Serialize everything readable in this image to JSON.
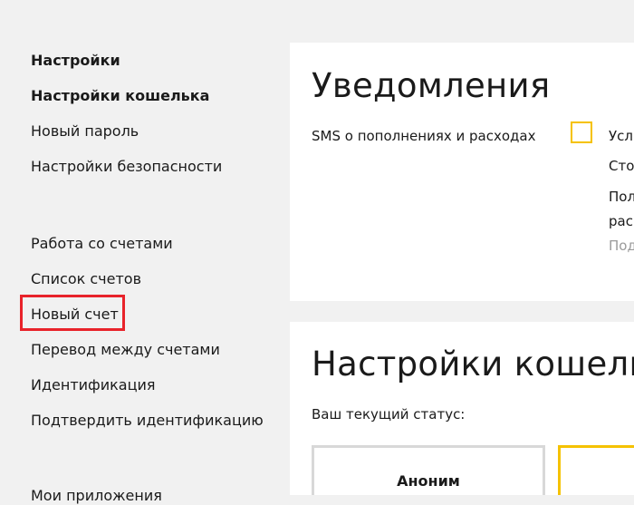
{
  "sidebar": {
    "items": [
      {
        "label": "Настройки"
      },
      {
        "label": "Настройки кошелька"
      },
      {
        "label": "Новый пароль"
      },
      {
        "label": "Настройки безопасности"
      },
      {
        "label": "Работа со счетами"
      },
      {
        "label": "Список счетов"
      },
      {
        "label": "Новый счет"
      },
      {
        "label": "Перевод между счетами"
      },
      {
        "label": "Идентификация"
      },
      {
        "label": "Подтвердить идентификацию"
      },
      {
        "label": "Мои приложения"
      }
    ]
  },
  "notifications": {
    "title": "Уведомления",
    "sms_label": "SMS о пополнениях и расходах",
    "checkbox_checked": false,
    "accent_color": "#f5c200",
    "right_lines": [
      "Усл",
      "Сто",
      "Пол",
      "рас"
    ],
    "right_link": "Под"
  },
  "wallet_settings": {
    "title": "Настройки кошелька",
    "status_label": "Ваш текущий статус:",
    "statuses": [
      "Аноним"
    ]
  },
  "highlight_color": "#e8232a"
}
